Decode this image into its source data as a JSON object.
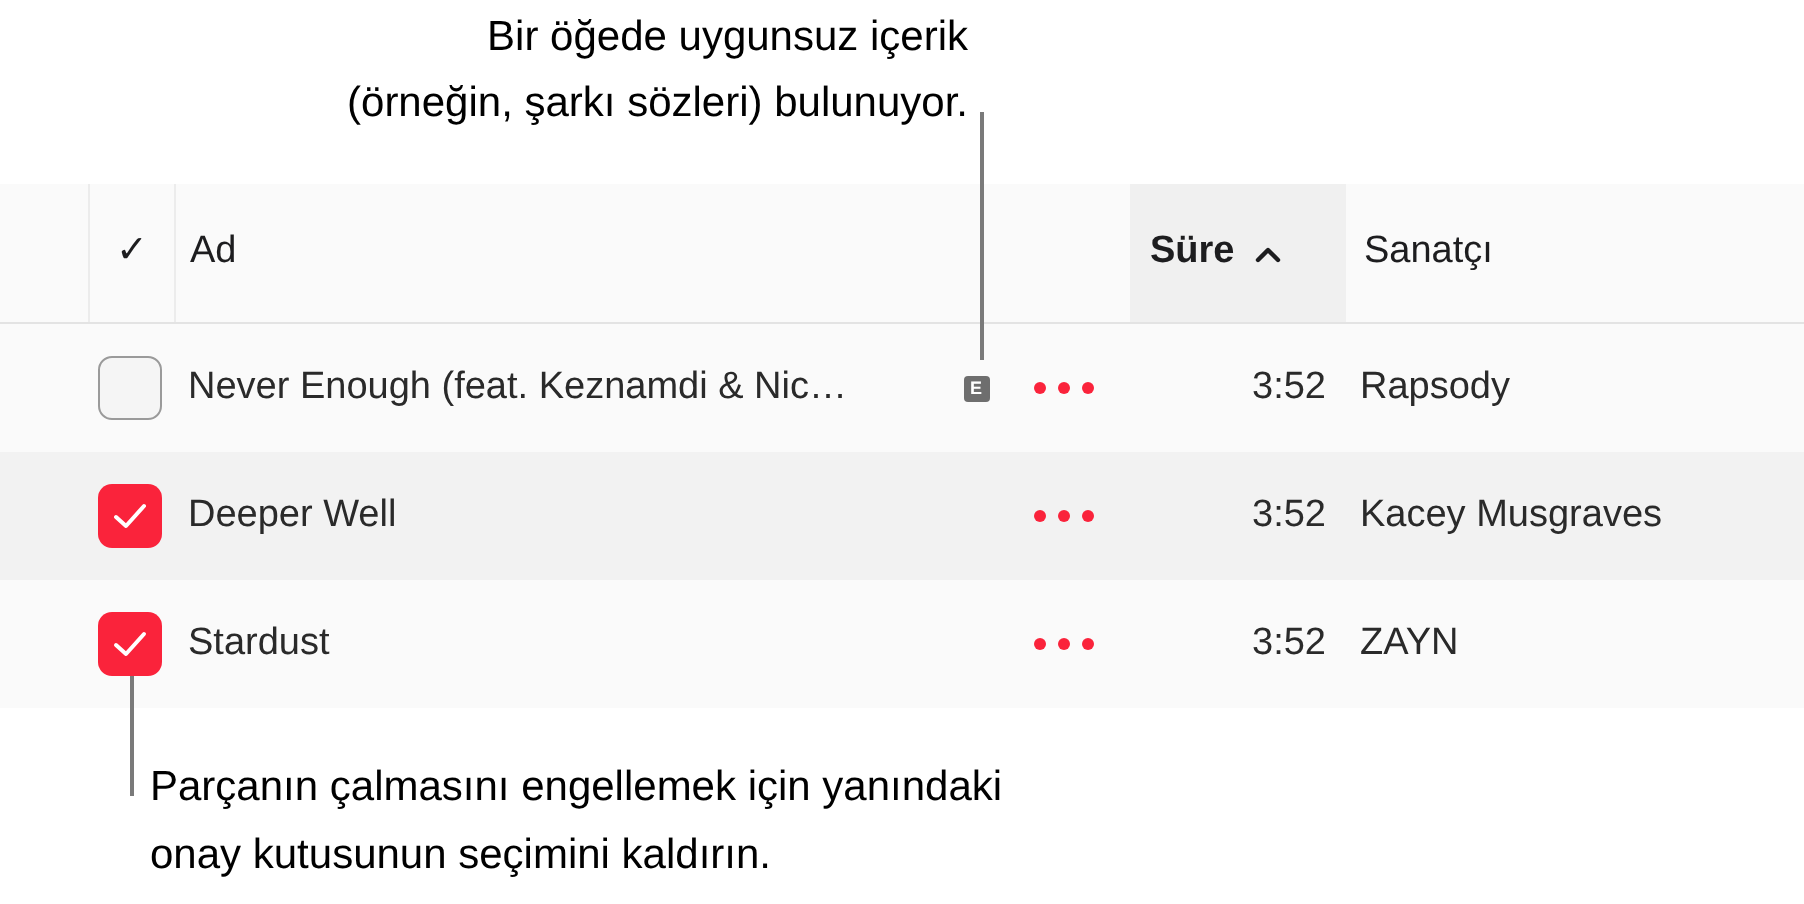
{
  "callouts": [
    {
      "text": "Bir öğede uygunsuz içerik\n(örneğin, şarkı sözleri) bulunuyor."
    },
    {
      "text": "Parçanın çalmasını engellemek için yanındaki\nonay kutusunun seçimini kaldırın."
    }
  ],
  "table": {
    "columns": [
      {
        "label": "✓",
        "sorted": false
      },
      {
        "label": "Ad",
        "sorted": false
      },
      {
        "label": "Süre",
        "sorted": true
      },
      {
        "label": "Sanatçı",
        "sorted": false
      }
    ],
    "rows": [
      {
        "checked": false,
        "name": "Never Enough (feat. Keznamdi & Nic…",
        "explicit": true,
        "explicit_label": "E",
        "duration": "3:52",
        "artist": "Rapsody"
      },
      {
        "checked": true,
        "name": "Deeper Well",
        "explicit": false,
        "duration": "3:52",
        "artist": "Kacey Musgraves"
      },
      {
        "checked": true,
        "name": "Stardust",
        "explicit": false,
        "duration": "3:52",
        "artist": "ZAYN"
      }
    ]
  }
}
